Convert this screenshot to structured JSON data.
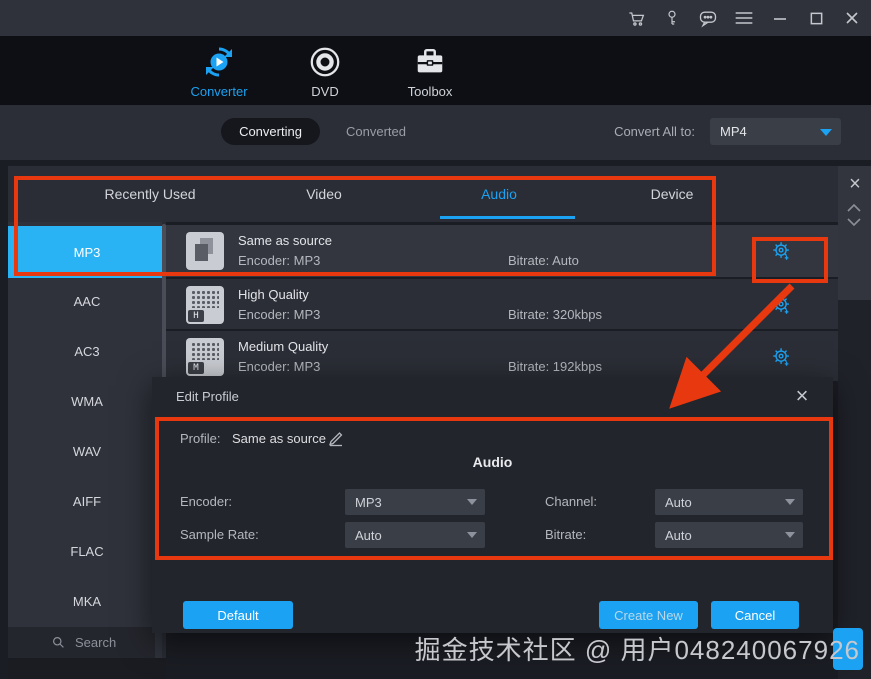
{
  "titlebar": {
    "icons": [
      "cart-icon",
      "key-icon",
      "chat-icon",
      "menu-icon",
      "minimize-icon",
      "maximize-icon",
      "close-icon"
    ]
  },
  "nav": {
    "items": [
      {
        "label": "Converter",
        "active": true
      },
      {
        "label": "DVD",
        "active": false
      },
      {
        "label": "Toolbox",
        "active": false
      }
    ]
  },
  "toolbar": {
    "converting_label": "Converting",
    "converted_label": "Converted",
    "convert_all_label": "Convert All to:",
    "convert_all_value": "MP4"
  },
  "drawer": {
    "tabs": [
      "Recently Used",
      "Video",
      "Audio",
      "Device"
    ],
    "active_tab": "Audio",
    "formats": [
      "MP3",
      "AAC",
      "AC3",
      "WMA",
      "WAV",
      "AIFF",
      "FLAC",
      "MKA"
    ],
    "selected_format": "MP3",
    "search_placeholder": "Search",
    "profiles": [
      {
        "name": "Same as source",
        "encoder": "Encoder: MP3",
        "bitrate": "Bitrate: Auto",
        "badge": ""
      },
      {
        "name": "High Quality",
        "encoder": "Encoder: MP3",
        "bitrate": "Bitrate: 320kbps",
        "badge": "H"
      },
      {
        "name": "Medium Quality",
        "encoder": "Encoder: MP3",
        "bitrate": "Bitrate: 192kbps",
        "badge": "M"
      }
    ]
  },
  "dialog": {
    "title": "Edit Profile",
    "profile_label": "Profile:",
    "profile_value": "Same as source",
    "section_title": "Audio",
    "fields": [
      {
        "label": "Encoder:",
        "value": "MP3"
      },
      {
        "label": "Channel:",
        "value": "Auto"
      },
      {
        "label": "Sample Rate:",
        "value": "Auto"
      },
      {
        "label": "Bitrate:",
        "value": "Auto"
      }
    ],
    "buttons": {
      "default": "Default",
      "create_new": "Create New",
      "cancel": "Cancel"
    }
  },
  "watermark": "掘金技术社区 @ 用户048240067926",
  "colors": {
    "accent": "#1ba2f2",
    "selected": "#29b2f4",
    "annotation": "#e8380f"
  }
}
